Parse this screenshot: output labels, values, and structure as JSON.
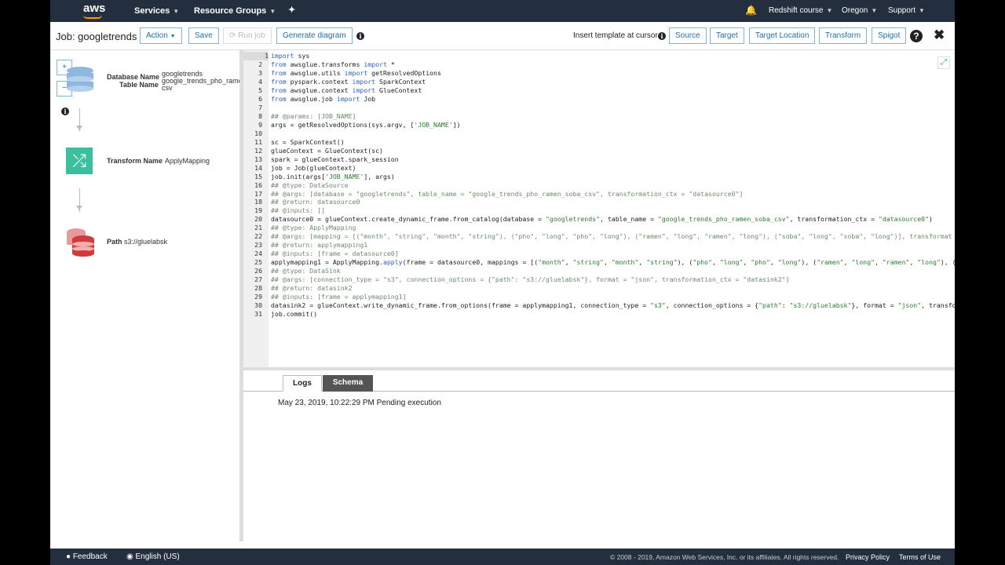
{
  "nav": {
    "logo": "aws",
    "services": "Services",
    "resource_groups": "Resource Groups",
    "account": "Redshift course",
    "region": "Oregon",
    "support": "Support"
  },
  "toolbar": {
    "title": "Job: googletrends",
    "action": "Action",
    "save": "Save",
    "run_job": "Run job",
    "generate_diagram": "Generate diagram",
    "insert_template": "Insert template at cursor",
    "source": "Source",
    "target": "Target",
    "target_location": "Target Location",
    "transform": "Transform",
    "spigot": "Spigot"
  },
  "diagram": {
    "source": {
      "db_label": "Database Name",
      "db_value": "googletrends",
      "table_label": "Table Name",
      "table_value": "google_trends_pho_rame",
      "table_value_wrap": "csv"
    },
    "transform": {
      "label": "Transform Name",
      "value": "ApplyMapping"
    },
    "target": {
      "label": "Path",
      "value": "s3://gluelabsk"
    },
    "colors": {
      "source": "#8fb8e0",
      "transform": "#3cbf9e",
      "target": "#d13a3a"
    }
  },
  "editor": {
    "lines": [
      "import sys",
      "from awsglue.transforms import *",
      "from awsglue.utils import getResolvedOptions",
      "from pyspark.context import SparkContext",
      "from awsglue.context import GlueContext",
      "from awsglue.job import Job",
      "",
      "## @params: [JOB_NAME]",
      "args = getResolvedOptions(sys.argv, ['JOB_NAME'])",
      "",
      "sc = SparkContext()",
      "glueContext = GlueContext(sc)",
      "spark = glueContext.spark_session",
      "job = Job(glueContext)",
      "job.init(args['JOB_NAME'], args)",
      "## @type: DataSource",
      "## @args: [database = \"googletrends\", table_name = \"google_trends_pho_ramen_soba_csv\", transformation_ctx = \"datasource0\"]",
      "## @return: datasource0",
      "## @inputs: []",
      "datasource0 = glueContext.create_dynamic_frame.from_catalog(database = \"googletrends\", table_name = \"google_trends_pho_ramen_soba_csv\", transformation_ctx = \"datasource0\")",
      "## @type: ApplyMapping",
      "## @args: [mapping = [(\"month\", \"string\", \"month\", \"string\"), (\"pho\", \"long\", \"pho\", \"long\"), (\"ramen\", \"long\", \"ramen\", \"long\"), (\"soba\", \"long\", \"soba\", \"long\")], transformat",
      "## @return: applymapping1",
      "## @inputs: [frame = datasource0]",
      "applymapping1 = ApplyMapping.apply(frame = datasource0, mappings = [(\"month\", \"string\", \"month\", \"string\"), (\"pho\", \"long\", \"pho\", \"long\"), (\"ramen\", \"long\", \"ramen\", \"long\"), (",
      "## @type: DataSink",
      "## @args: [connection_type = \"s3\", connection_options = {\"path\": \"s3://gluelabsk\"}, format = \"json\", transformation_ctx = \"datasink2\"]",
      "## @return: datasink2",
      "## @inputs: [frame = applymapping1]",
      "datasink2 = glueContext.write_dynamic_frame.from_options(frame = applymapping1, connection_type = \"s3\", connection_options = {\"path\": \"s3://gluelabsk\"}, format = \"json\", transfo",
      "job.commit()"
    ]
  },
  "bottom": {
    "tabs": [
      {
        "label": "Logs",
        "active": true
      },
      {
        "label": "Schema",
        "active": false
      }
    ],
    "log": "May 23, 2019, 10:22:29 PM Pending execution"
  },
  "footer": {
    "feedback": "Feedback",
    "language": "English (US)",
    "copyright": "© 2008 - 2019, Amazon Web Services, Inc. or its affiliates. All rights reserved.",
    "privacy": "Privacy Policy",
    "terms": "Terms of Use"
  }
}
